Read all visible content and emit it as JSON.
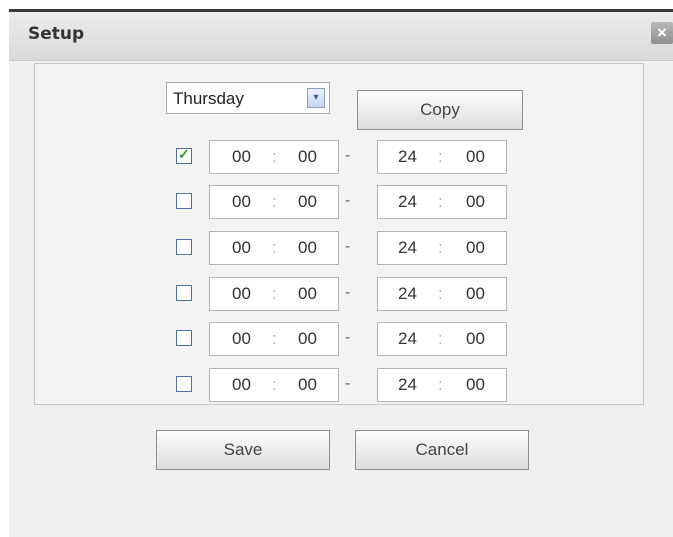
{
  "dialog": {
    "title": "Setup",
    "close_glyph": "×"
  },
  "day_select": {
    "value": "Thursday",
    "arrow_glyph": "▾"
  },
  "buttons": {
    "copy": "Copy",
    "save": "Save",
    "cancel": "Cancel"
  },
  "periods": [
    {
      "checked": true,
      "check_glyph": "✓",
      "start_h": "00",
      "start_m": "00",
      "end_h": "24",
      "end_m": "00"
    },
    {
      "checked": false,
      "check_glyph": "",
      "start_h": "00",
      "start_m": "00",
      "end_h": "24",
      "end_m": "00"
    },
    {
      "checked": false,
      "check_glyph": "",
      "start_h": "00",
      "start_m": "00",
      "end_h": "24",
      "end_m": "00"
    },
    {
      "checked": false,
      "check_glyph": "",
      "start_h": "00",
      "start_m": "00",
      "end_h": "24",
      "end_m": "00"
    },
    {
      "checked": false,
      "check_glyph": "",
      "start_h": "00",
      "start_m": "00",
      "end_h": "24",
      "end_m": "00"
    },
    {
      "checked": false,
      "check_glyph": "",
      "start_h": "00",
      "start_m": "00",
      "end_h": "24",
      "end_m": "00"
    }
  ],
  "separators": {
    "time": ":",
    "range": "-"
  }
}
